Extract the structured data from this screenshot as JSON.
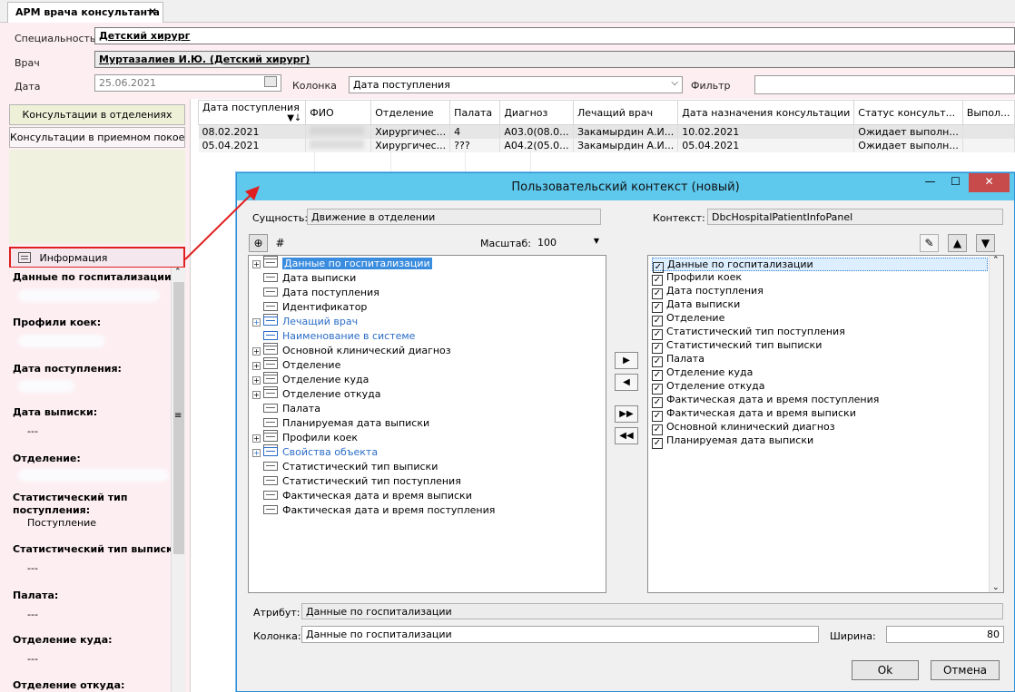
{
  "tab": {
    "title": "АРМ врача консультанта",
    "close": "✕"
  },
  "form": {
    "specialty_label": "Специальность",
    "specialty_value": "Детский хирург",
    "doctor_label": "Врач",
    "doctor_value": "Муртазалиев И.Ю. (Детский хирург)",
    "date_label": "Дата",
    "date_value": "25.06.2021",
    "column_label": "Колонка",
    "column_value": "Дата поступления",
    "filter_label": "Фильтр",
    "filter_value": ""
  },
  "nav": {
    "dept_consults": "Консультации в отделениях",
    "er_consults": "Консультации в приемном покое"
  },
  "info": {
    "header": "Информация",
    "fields": [
      {
        "label": "Данные по госпитализации:",
        "value": ""
      },
      {
        "label": "Профили коек:",
        "value": ""
      },
      {
        "label": "Дата поступления:",
        "value": ""
      },
      {
        "label": "Дата выписки:",
        "value": "---"
      },
      {
        "label": "Отделение:",
        "value": ""
      },
      {
        "label": "Статистический тип",
        "label2": "поступления:",
        "value": "Поступление"
      },
      {
        "label": "Статистический тип выписки:",
        "value": "---"
      },
      {
        "label": "Палата:",
        "value": "---"
      },
      {
        "label": "Отделение куда:",
        "value": "---"
      },
      {
        "label": "Отделение откуда:",
        "value": ""
      }
    ]
  },
  "grid": {
    "columns": [
      "Дата поступления",
      "ФИО",
      "Отделение",
      "Палата",
      "Диагноз",
      "Лечащий врач",
      "Дата назначения консультации",
      "Статус консульт...",
      "Выпол..."
    ],
    "rows": [
      [
        "08.02.2021",
        "",
        "Хирургичес...",
        "4",
        "A03.0(08.0...",
        "Закамырдин А.И...",
        "10.02.2021",
        "Ожидает выполн...",
        ""
      ],
      [
        "05.04.2021",
        "",
        "Хирургичес...",
        "???",
        "A04.2(05.0...",
        "Закамырдин А.И...",
        "05.04.2021",
        "Ожидает выполн...",
        ""
      ]
    ]
  },
  "dialog": {
    "title": "Пользовательский контекст (новый)",
    "entity_label": "Сущность:",
    "entity_value": "Движение в отделении",
    "scale_label": "Масштаб:",
    "scale_value": "100",
    "context_label": "Контекст:",
    "context_value": "DbcHospitalPatientInfoPanel",
    "tree": [
      {
        "label": "Данные по госпитализации",
        "expand": true,
        "multi": true,
        "blue": false,
        "selected": true
      },
      {
        "label": "Дата выписки",
        "expand": false,
        "multi": false,
        "blue": false
      },
      {
        "label": "Дата поступления",
        "expand": false,
        "multi": false,
        "blue": false
      },
      {
        "label": "Идентификатор",
        "expand": false,
        "multi": false,
        "blue": false
      },
      {
        "label": "Лечащий врач",
        "expand": true,
        "multi": true,
        "blue": true
      },
      {
        "label": "Наименование в системе",
        "expand": false,
        "multi": false,
        "blue": true
      },
      {
        "label": "Основной клинический диагноз",
        "expand": true,
        "multi": true,
        "blue": false
      },
      {
        "label": "Отделение",
        "expand": true,
        "multi": true,
        "blue": false
      },
      {
        "label": "Отделение куда",
        "expand": true,
        "multi": true,
        "blue": false
      },
      {
        "label": "Отделение откуда",
        "expand": true,
        "multi": true,
        "blue": false
      },
      {
        "label": "Палата",
        "expand": false,
        "multi": false,
        "blue": false
      },
      {
        "label": "Планируемая дата выписки",
        "expand": false,
        "multi": false,
        "blue": false
      },
      {
        "label": "Профили коек",
        "expand": true,
        "multi": true,
        "blue": false
      },
      {
        "label": "Свойства объекта",
        "expand": true,
        "multi": true,
        "blue": true
      },
      {
        "label": "Статистический тип выписки",
        "expand": false,
        "multi": false,
        "blue": false
      },
      {
        "label": "Статистический тип поступления",
        "expand": false,
        "multi": false,
        "blue": false
      },
      {
        "label": "Фактическая дата и время выписки",
        "expand": false,
        "multi": false,
        "blue": false
      },
      {
        "label": "Фактическая дата и время поступления",
        "expand": false,
        "multi": false,
        "blue": false
      }
    ],
    "context_items": [
      "Данные по госпитализации",
      "Профили коек",
      "Дата поступления",
      "Дата выписки",
      "Отделение",
      "Статистический тип поступления",
      "Статистический тип выписки",
      "Палата",
      "Отделение куда",
      "Отделение откуда",
      "Фактическая дата и время поступления",
      "Фактическая дата и время выписки",
      "Основной клинический диагноз",
      "Планируемая дата выписки"
    ],
    "attribute_label": "Атрибут:",
    "attribute_value": "Данные по госпитализации",
    "column_label": "Колонка:",
    "column_value": "Данные по госпитализации",
    "width_label": "Ширина:",
    "width_value": "80",
    "ok": "Ok",
    "cancel": "Отмена"
  },
  "colors": {
    "dialog_title": "#5ec8ed",
    "close_button": "#c74b4b",
    "highlight_border": "#e02020",
    "selection": "#3a8cde",
    "panel_bg": "#fdeef2"
  }
}
